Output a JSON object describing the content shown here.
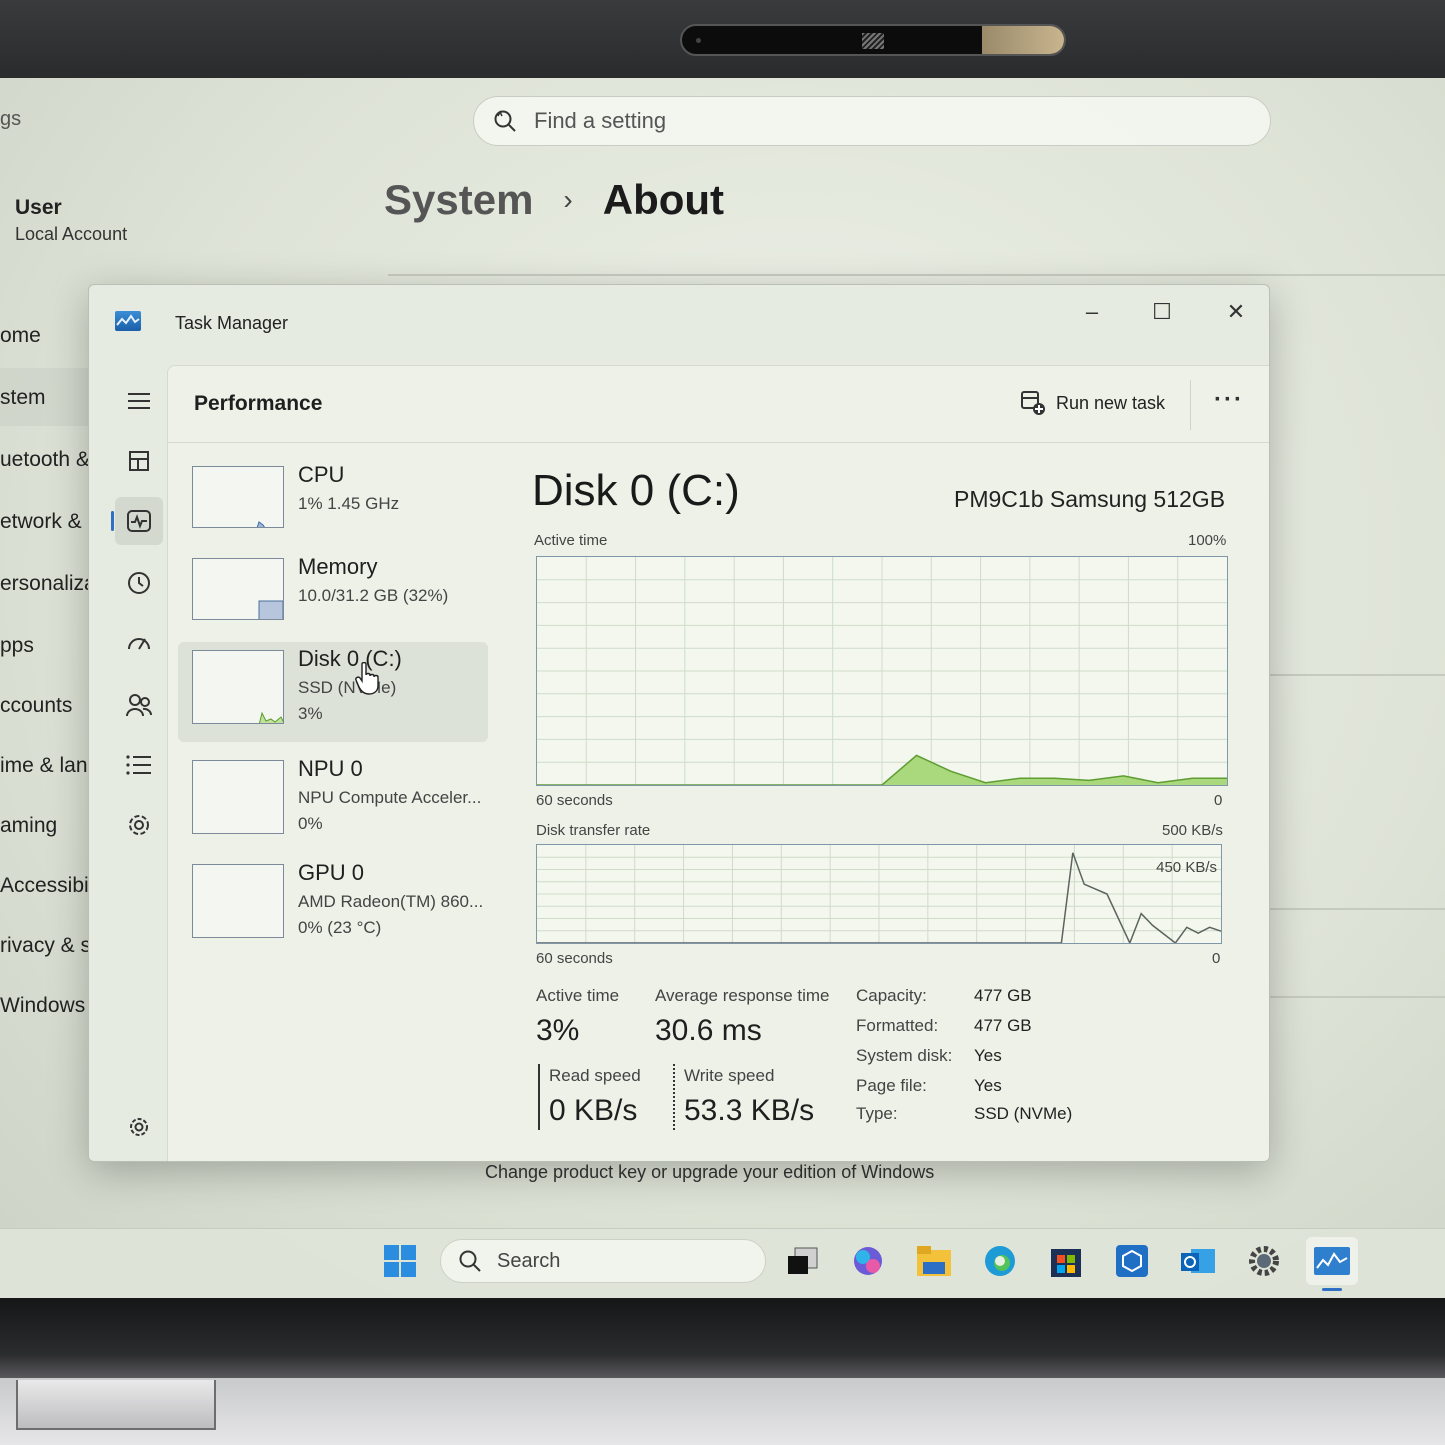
{
  "settings": {
    "title_partial": "gs",
    "search_placeholder": "Find a setting",
    "user": {
      "name": "User",
      "account_type": "Local Account"
    },
    "breadcrumb": {
      "parent": "System",
      "separator": "›",
      "current": "About"
    },
    "nav": [
      "ome",
      "stem",
      "uetooth &",
      "etwork & i",
      "ersonalizat",
      "pps",
      "ccounts",
      "ime & lang",
      "aming",
      "Accessibility",
      "rivacy & se",
      "Windows Up"
    ],
    "product_key_text": "Change product key or upgrade your edition of Windows"
  },
  "task_manager": {
    "window_title": "Task Manager",
    "window_controls": {
      "minimize": "–",
      "maximize": "☐",
      "close": "✕"
    },
    "header": {
      "title": "Performance",
      "run_new_task": "Run new task",
      "more": "···"
    },
    "devices": [
      {
        "name": "CPU",
        "line1": "1%  1.45 GHz",
        "line2": "",
        "usage_fraction": 0.01
      },
      {
        "name": "Memory",
        "line1": "10.0/31.2 GB (32%)",
        "line2": "",
        "usage_fraction": 0.32
      },
      {
        "name": "Disk 0 (C:)",
        "line1": "SSD (NVMe)",
        "line2": "3%",
        "usage_fraction": 0.03,
        "selected": true
      },
      {
        "name": "NPU 0",
        "line1": "NPU Compute Acceler...",
        "line2": "0%",
        "usage_fraction": 0.0
      },
      {
        "name": "GPU 0",
        "line1": "AMD Radeon(TM) 860...",
        "line2": "0%  (23 °C)",
        "usage_fraction": 0.0
      }
    ],
    "detail": {
      "title": "Disk 0 (C:)",
      "model": "PM9C1b Samsung 512GB",
      "graph1": {
        "label": "Active time",
        "max_label": "100%",
        "x_label": "60 seconds",
        "x_end_label": "0"
      },
      "graph2": {
        "label": "Disk transfer rate",
        "max_label": "500 KB/s",
        "inner_label": "450 KB/s",
        "x_label": "60 seconds",
        "x_end_label": "0"
      },
      "stats": {
        "active_time_label": "Active time",
        "active_time": "3%",
        "avg_response_label": "Average response time",
        "avg_response": "30.6 ms",
        "read_label": "Read speed",
        "read": "0 KB/s",
        "write_label": "Write speed",
        "write": "53.3 KB/s"
      },
      "info": [
        {
          "k": "Capacity:",
          "v": "477 GB"
        },
        {
          "k": "Formatted:",
          "v": "477 GB"
        },
        {
          "k": "System disk:",
          "v": "Yes"
        },
        {
          "k": "Page file:",
          "v": "Yes"
        },
        {
          "k": "Type:",
          "v": "SSD (NVMe)"
        }
      ]
    }
  },
  "taskbar": {
    "search_label": "Search"
  },
  "chart_data": [
    {
      "type": "area",
      "title": "Active time",
      "xlabel": "60 seconds",
      "ylim": [
        0,
        100
      ],
      "x": [
        0,
        30,
        33,
        36,
        39,
        42,
        45,
        48,
        51,
        54,
        57,
        60
      ],
      "values": [
        0,
        0,
        13,
        6,
        1,
        3,
        3,
        2,
        4,
        1,
        3,
        3
      ]
    },
    {
      "type": "line",
      "title": "Disk transfer rate",
      "xlabel": "60 seconds",
      "ylim": [
        0,
        500
      ],
      "x": [
        0,
        46,
        47,
        48,
        50,
        52,
        53,
        54,
        56,
        57,
        58,
        59,
        60
      ],
      "values": [
        0,
        0,
        460,
        300,
        250,
        0,
        150,
        90,
        0,
        80,
        50,
        80,
        60
      ]
    }
  ]
}
